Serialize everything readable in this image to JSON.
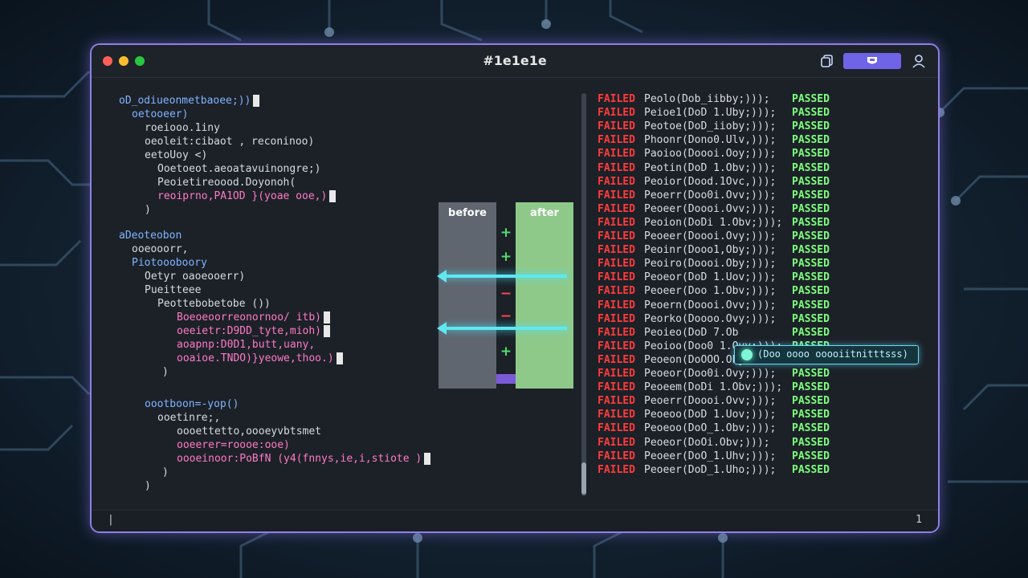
{
  "window": {
    "title": "#1e1e1e"
  },
  "toolbar": {
    "copy_icon": "copy-icon",
    "shield_icon": "shield-icon",
    "user_icon": "user-icon"
  },
  "code_lines": [
    "oD_odiueonmetbaoee;))",
    "oetooeer)",
    "roeiooo.1iny",
    "oeoleit:cibaot , reconinoo)",
    "eetoUoy <)",
    "Ooetoeot.aeoatavuinongre;)",
    "Peoietireoood.Doyonoh(",
    "reoiprno,PA1OD }(yoae ooe,)",
    ")",
    "aDeoteobon",
    "ooeooorr,",
    "Piotoooboory",
    "Oetyr oaoeooerr)",
    "Pueitteee",
    "Peottebobetobe ())",
    "Boeoeoorreonornoo/ itb)",
    "oeeietr:D9DD_tyte,mioh)",
    "aoapnp:D0D1,butt,uany,",
    "ooaioe.TNDO)}yeowe,thoo.)",
    ")",
    "oootboon=-yop()",
    "ooetinre;,",
    "oooettetto,oooeyvbtsmet",
    "ooeerer=roooe:ooe)",
    "oooeinoor:PoBfN (y4(fnnys,ie,i,stiote )",
    ")",
    ")"
  ],
  "diff": {
    "before_label": "before",
    "after_label": "after",
    "marks": [
      "+",
      "+",
      "−",
      "−",
      "+"
    ]
  },
  "test_log": {
    "failed_label": "FAILED",
    "passed_label": "PASSED",
    "rows": [
      "Peolo(Dob_iibby;)));",
      "Peioe1(DoD 1.Uby;)));",
      "Peotoe(DoD_iioby;)));",
      "Phoonr(Dono0.Ulv,)));",
      "Paoioo(Doooi.Ooy;)));",
      "Peotin(DoD 1.Obv;)));",
      "Peoior(Dood.1Ovc,)));",
      "Peoerr(Doo0i.Ovv;)));",
      "Peoeer(Doooi.Ovv;)));",
      "Peoion(DoDi 1.Obv;)));",
      "Peoeer(Doooi.Ovy;)));",
      "Peoinr(Dooo1,Oby;)));",
      "Peoiro(Doooi.Oby;)));",
      "Peoeor(DoD 1.Uov;)));",
      "Peoeer(Doo 1.Obv;)));",
      "Peoern(Doooi.Ovv;)));",
      "Peorko(Doooo.Ovy;)));",
      "Peoieo(DoD 7.Ob",
      "Peoioo(Doo0 1.Ovv;)));",
      "Peoeon(DoOOO.Oby;)));",
      "Peoeor(Doo0i.Ovy;)));",
      "Peoeem(DoDi 1.Obv;)));",
      "Peoerr(Doooi.Ovv;)));",
      "Peoeoo(DoD 1.Uov;)));",
      "Peoeoo(DoO_1.Obv;)));",
      "Peoeor(DoOi.Obv;)));",
      "Peoeer(DoO_1.Uhv;)));",
      "Peoeer(DoD_1.Uho;)));"
    ],
    "tooltip_text": "(Doo oooo ooooiitnitttsss)"
  },
  "status": {
    "left": "|",
    "right": "1"
  },
  "colors": {
    "frame": "#8f7ee8",
    "failed": "#ff3b3b",
    "passed": "#7dff7d",
    "diff_after": "#8fc98a",
    "diff_before": "#5f6670",
    "arrow": "#5fe8f0"
  }
}
